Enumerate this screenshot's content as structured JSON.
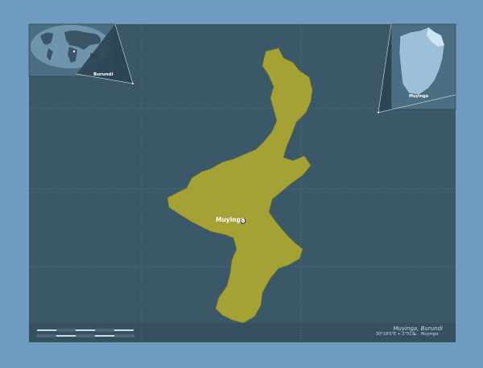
{
  "region": {
    "name": "Muyinga",
    "country": "Burundi"
  },
  "title": "Muyinga, Burundi",
  "coordinates": "30°19'0\"E + 2°51'S",
  "legend": {
    "label": "Muyinga",
    "color": "#a4a234"
  },
  "insets": {
    "world_label": "Burundi",
    "country_label": "Muyinga"
  },
  "colors": {
    "ocean": "#6e9bbf",
    "map_bg": "#3b5868",
    "region": "#a4a234",
    "graticule": "#8fb0c5"
  }
}
